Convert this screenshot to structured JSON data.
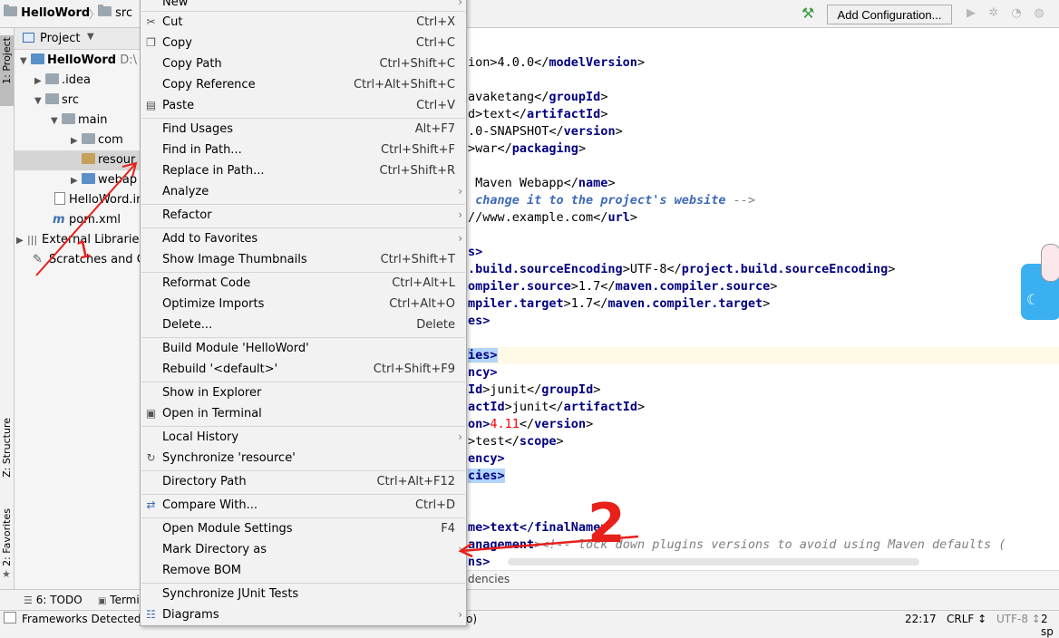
{
  "navbar": {
    "project": "HelloWord",
    "src": "src",
    "add_configuration": "Add Configuration..."
  },
  "left_strip": {
    "project_tab": "1: Project",
    "structure_tab": "Z: Structure",
    "favorites_tab": "2: Favorites"
  },
  "project_panel": {
    "title": "Project",
    "tree": {
      "root": "HelloWord",
      "root_path": "D:\\",
      "idea": ".idea",
      "src": "src",
      "main": "main",
      "com": "com",
      "resources": "resour",
      "webapp": "webap",
      "iml": "HelloWord.in",
      "pom": "pom.xml",
      "external": "External Librarie",
      "scratches": "Scratches and C"
    }
  },
  "context_menu": {
    "items": {
      "new": {
        "label": "New"
      },
      "cut": {
        "label": "Cut",
        "shortcut": "Ctrl+X"
      },
      "copy": {
        "label": "Copy",
        "shortcut": "Ctrl+C"
      },
      "copy_path": {
        "label": "Copy Path",
        "shortcut": "Ctrl+Shift+C"
      },
      "copy_reference": {
        "label": "Copy Reference",
        "shortcut": "Ctrl+Alt+Shift+C"
      },
      "paste": {
        "label": "Paste",
        "shortcut": "Ctrl+V"
      },
      "find_usages": {
        "label": "Find Usages",
        "shortcut": "Alt+F7"
      },
      "find_in_path": {
        "label": "Find in Path...",
        "shortcut": "Ctrl+Shift+F"
      },
      "replace_in_path": {
        "label": "Replace in Path...",
        "shortcut": "Ctrl+Shift+R"
      },
      "analyze": {
        "label": "Analyze"
      },
      "refactor": {
        "label": "Refactor"
      },
      "add_to_favorites": {
        "label": "Add to Favorites"
      },
      "show_image_thumbnails": {
        "label": "Show Image Thumbnails",
        "shortcut": "Ctrl+Shift+T"
      },
      "reformat_code": {
        "label": "Reformat Code",
        "shortcut": "Ctrl+Alt+L"
      },
      "optimize_imports": {
        "label": "Optimize Imports",
        "shortcut": "Ctrl+Alt+O"
      },
      "delete": {
        "label": "Delete...",
        "shortcut": "Delete"
      },
      "build_module": {
        "label": "Build Module 'HelloWord'"
      },
      "rebuild": {
        "label": "Rebuild '<default>'",
        "shortcut": "Ctrl+Shift+F9"
      },
      "show_in_explorer": {
        "label": "Show in Explorer"
      },
      "open_in_terminal": {
        "label": "Open in Terminal"
      },
      "local_history": {
        "label": "Local History"
      },
      "synchronize": {
        "label": "Synchronize 'resource'"
      },
      "directory_path": {
        "label": "Directory Path",
        "shortcut": "Ctrl+Alt+F12"
      },
      "compare_with": {
        "label": "Compare With...",
        "shortcut": "Ctrl+D"
      },
      "open_module_settings": {
        "label": "Open Module Settings",
        "shortcut": "F4"
      },
      "mark_directory_as": {
        "label": "Mark Directory as"
      },
      "remove_bom": {
        "label": "Remove BOM"
      },
      "sync_junit": {
        "label": "Synchronize JUnit Tests"
      },
      "diagrams": {
        "label": "Diagrams"
      }
    }
  },
  "editor": {
    "lines": {
      "l1a": "ion>4.0.0</",
      "l1b": "modelVersion",
      "l1c": ">",
      "l2a": "avaketang</",
      "l2b": "groupId",
      "l2c": ">",
      "l3a": "d>text</",
      "l3b": "artifactId",
      "l3c": ">",
      "l4a": ".0-SNAPSHOT</",
      "l4b": "version",
      "l4c": ">",
      "l5a": ">war</",
      "l5b": "packaging",
      "l5c": ">",
      "l6a": " Maven Webapp</",
      "l6b": "name",
      "l6c": ">",
      "l7a": " change it to the project's website ",
      "l7b": "-->",
      "l8a": "//www.example.com</",
      "l8b": "url",
      "l8c": ">",
      "l9a": "s>",
      "l10a": ".build.sourceEncoding",
      "l10b": ">UTF-8</",
      "l10c": "project.build.sourceEncoding",
      "l10d": ">",
      "l11a": "ompiler.source",
      "l11b": ">1.7</",
      "l11c": "maven.compiler.source",
      "l11d": ">",
      "l12a": "mpiler.target",
      "l12b": ">1.7</",
      "l12c": "maven.compiler.target",
      "l12d": ">",
      "l13a": "es>",
      "l14a": "ies>",
      "l15a": "ncy>",
      "l16a": "Id",
      "l16b": ">junit</",
      "l16c": "groupId",
      "l16d": ">",
      "l17a": "actId",
      "l17b": ">junit</",
      "l17c": "artifactId",
      "l17d": ">",
      "l18a": "on>",
      "l18b": "4.11",
      "l18c": "</",
      "l18d": "version",
      "l18e": ">",
      "l19a": ">test</",
      "l19b": "scope",
      "l19c": ">",
      "l20a": "ency>",
      "l21a": "cies>",
      "l22a": "me>text</",
      "l22b": "finalName",
      "l22c": ">",
      "l23a": "anagement",
      "l23b": "><!-- lock down plugins versions to avoid using Maven defaults (",
      "l24a": "ns>"
    },
    "breadcrumb": "dencies"
  },
  "bottom_tools": {
    "todo": "6: TODO",
    "terminal": "Termi"
  },
  "status": {
    "message": "Frameworks Detected",
    "tail": "o)",
    "position": "22:17",
    "line_sep": "CRLF ↕",
    "encoding": "UTF-8 ↕",
    "indent": "2 sp"
  },
  "annotations": {
    "one": "1",
    "two": "2"
  },
  "colors": {
    "annotation_red": "#e8201a",
    "selection": "#d5d5d5",
    "xml_tag": "#000080"
  }
}
